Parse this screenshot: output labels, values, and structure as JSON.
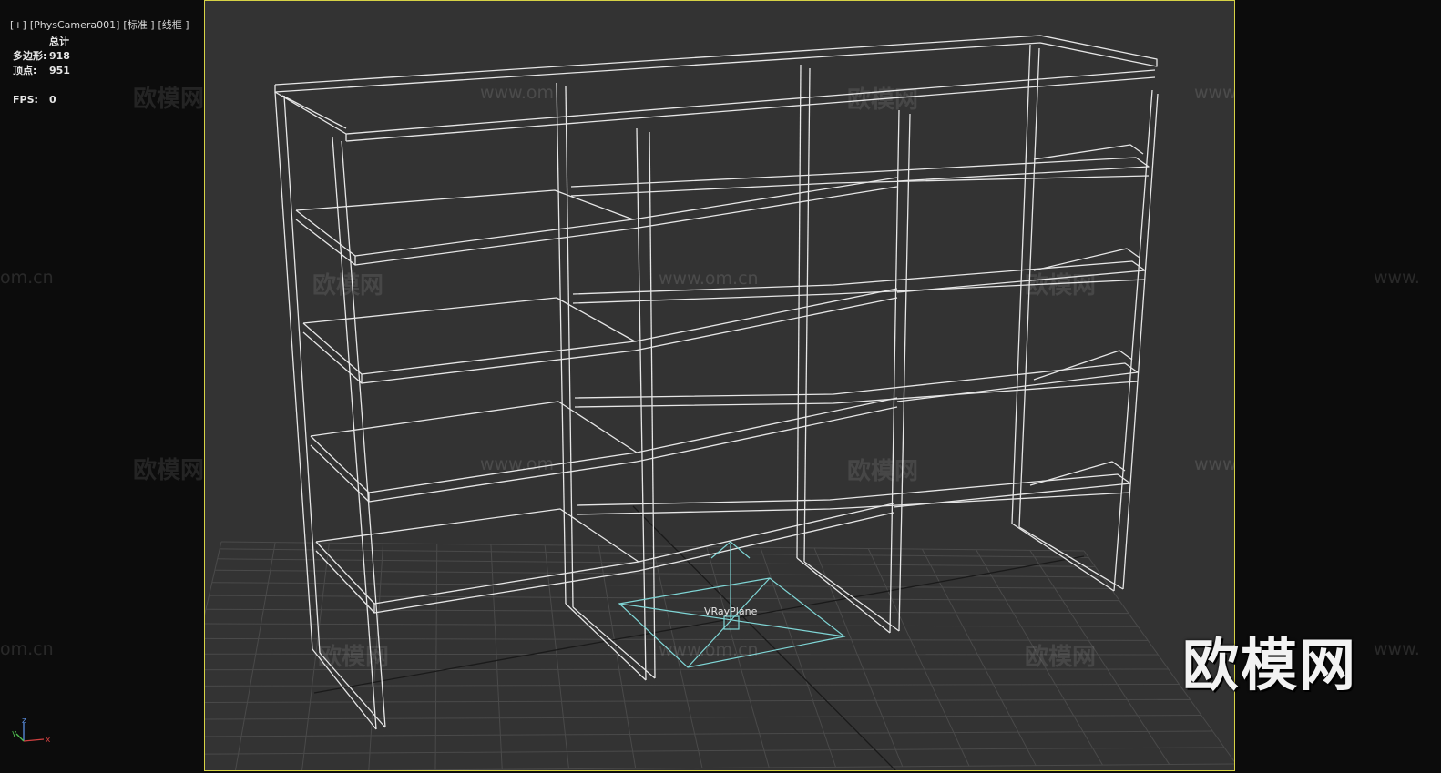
{
  "viewport_label": {
    "plus": "[+]",
    "camera": "[PhysCamera001]",
    "shading": "[标准 ]",
    "mode": "[线框 ]"
  },
  "stats": {
    "title": "总计",
    "polygons_label": "多边形:",
    "polygons_value": "918",
    "vertices_label": "顶点:",
    "vertices_value": "951",
    "fps_label": "FPS:",
    "fps_value": "0"
  },
  "scene": {
    "object_label": "VRayPlane",
    "wire_color": "#e6e6e6",
    "helper_color": "#7fd6d6",
    "grid_color": "#4a4a4a"
  },
  "watermarks": {
    "brand": "欧模网",
    "url": "www.om.cn",
    "url_short_left": "om.cn",
    "url_short_right": "www.",
    "url_partial": "www.om"
  },
  "logo": {
    "text": "欧模网"
  },
  "axes": {
    "x": "x",
    "y": "y",
    "z": "z"
  },
  "colors": {
    "viewport_border": "#d6d245",
    "viewport_bg": "#333333",
    "panel_bg": "#0c0c0c"
  }
}
